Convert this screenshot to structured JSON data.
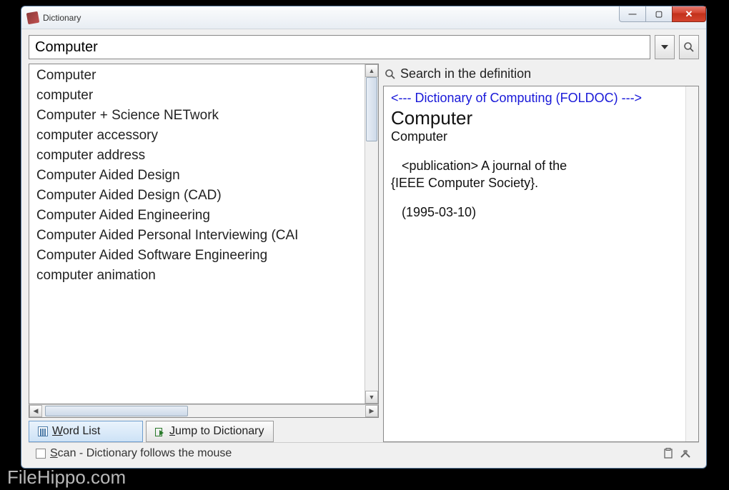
{
  "window": {
    "title": "Dictionary"
  },
  "search": {
    "value": "Computer"
  },
  "wordlist": {
    "items": [
      "Computer",
      "computer",
      "Computer + Science NETwork",
      "computer accessory",
      "computer address",
      "Computer Aided Design",
      "Computer Aided Design (CAD)",
      "Computer Aided Engineering",
      "Computer Aided Personal Interviewing (CAI",
      "Computer Aided Software Engineering",
      "computer animation"
    ]
  },
  "tabs": {
    "wordlist": "Word List",
    "jump": "Jump to Dictionary"
  },
  "rightPane": {
    "searchDefLabel": "Search in the definition"
  },
  "definition": {
    "source": "<--- Dictionary of Computing (FOLDOC) --->",
    "headword": "Computer",
    "sub": "Computer",
    "bodyIndent": "   <publication> A journal of the",
    "body2": "{IEEE Computer Society}.",
    "date": "   (1995-03-10)"
  },
  "status": {
    "scan": "Scan - Dictionary follows the mouse"
  },
  "watermark": "FileHippo.com"
}
